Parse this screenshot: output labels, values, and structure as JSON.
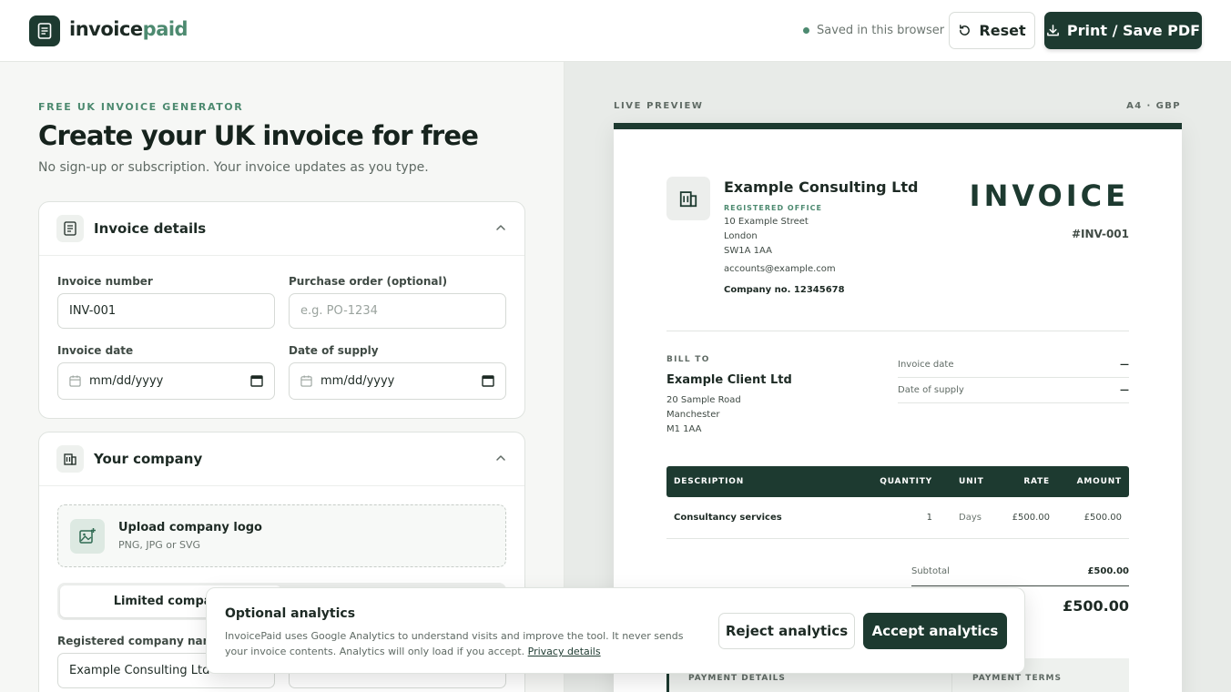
{
  "header": {
    "brand_part1": "invoice",
    "brand_part2": "paid",
    "saved_status": "Saved in this browser",
    "reset_label": "Reset",
    "print_label": "Print / Save PDF"
  },
  "intro": {
    "eyebrow": "FREE UK INVOICE GENERATOR",
    "title": "Create your UK invoice for free",
    "subtitle": "No sign-up or subscription. Your invoice updates as you type."
  },
  "invoice_details": {
    "title": "Invoice details",
    "invoice_number_label": "Invoice number",
    "invoice_number_value": "INV-001",
    "po_label": "Purchase order (optional)",
    "po_placeholder": "e.g. PO-1234",
    "invoice_date_label": "Invoice date",
    "invoice_date_value": "mm/dd/yyyy",
    "supply_date_label": "Date of supply",
    "supply_date_value": "mm/dd/yyyy"
  },
  "company": {
    "title": "Your company",
    "upload_title": "Upload company logo",
    "upload_sub": "PNG, JPG or SVG",
    "type_selected": "Limited company",
    "name_label": "Registered company name",
    "name_value": "Example Consulting Ltd",
    "number_value": "12345678"
  },
  "preview": {
    "label": "LIVE PREVIEW",
    "format": "A4 · GBP",
    "company_name": "Example Consulting Ltd",
    "registered_office": "REGISTERED OFFICE",
    "address": [
      "10 Example Street",
      "London",
      "SW1A 1AA"
    ],
    "email": "accounts@example.com",
    "company_no": "Company no. 12345678",
    "doc_title": "INVOICE",
    "doc_number": "#INV-001",
    "bill_to_label": "BILL TO",
    "client_name": "Example Client Ltd",
    "client_address": [
      "20 Sample Road",
      "Manchester",
      "M1 1AA"
    ],
    "meta": [
      {
        "label": "Invoice date",
        "value": "—"
      },
      {
        "label": "Date of supply",
        "value": "—"
      }
    ],
    "table_headers": {
      "description": "DESCRIPTION",
      "quantity": "QUANTITY",
      "unit": "UNIT",
      "rate": "RATE",
      "amount": "AMOUNT"
    },
    "row": {
      "description": "Consultancy services",
      "quantity": "1",
      "unit": "Days",
      "rate": "£500.00",
      "amount": "£500.00"
    },
    "subtotal_label": "Subtotal",
    "subtotal_value": "£500.00",
    "total_value": "£500.00",
    "payment_details_label": "PAYMENT DETAILS",
    "payment_terms_label": "PAYMENT TERMS"
  },
  "consent": {
    "title": "Optional analytics",
    "text": "InvoicePaid uses Google Analytics to understand visits and improve the tool. It never sends your invoice contents. Analytics will only load if you accept.",
    "link": "Privacy details",
    "reject_label": "Reject analytics",
    "accept_label": "Accept analytics"
  }
}
